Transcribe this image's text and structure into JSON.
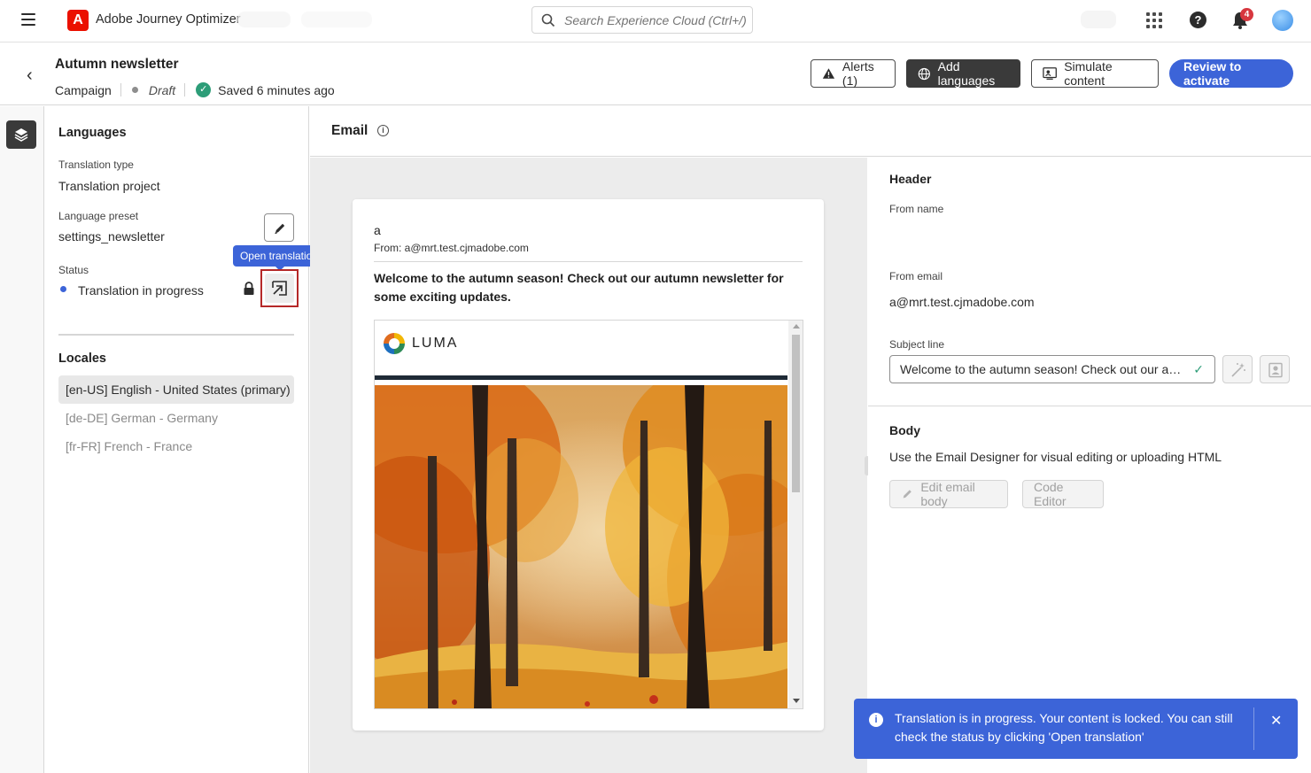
{
  "app": {
    "name": "Adobe Journey Optimizer",
    "logo_letter": "A",
    "brand_color": "#eb1000",
    "accent_color": "#3c64d8"
  },
  "search": {
    "placeholder": "Search Experience Cloud (Ctrl+/)"
  },
  "topbar": {
    "notification_count": "4",
    "help_label": "?"
  },
  "campaign": {
    "title": "Autumn newsletter",
    "type": "Campaign",
    "state": "Draft",
    "saved_text": "Saved 6 minutes ago",
    "actions": {
      "alerts": "Alerts (1)",
      "add_languages": "Add languages",
      "simulate": "Simulate content",
      "review": "Review to activate"
    }
  },
  "languages_panel": {
    "title": "Languages",
    "translation_type_label": "Translation type",
    "translation_type_value": "Translation project",
    "preset_label": "Language preset",
    "preset_value": "settings_newsletter",
    "status_label": "Status",
    "status_value": "Translation in progress",
    "status_color": "#3c64d8",
    "tooltip": "Open translation",
    "locales_title": "Locales",
    "locales": [
      {
        "label": "[en-US] English - United States (primary)",
        "active": true
      },
      {
        "label": "[de-DE] German - Germany",
        "active": false
      },
      {
        "label": "[fr-FR] French - France",
        "active": false
      }
    ]
  },
  "email": {
    "section_title": "Email",
    "info_glyph": "i",
    "from_name": "a",
    "from_line": "From: a@mrt.test.cjmadobe.com",
    "subject": "Welcome to the autumn season! Check out our autumn newsletter for some exciting updates.",
    "brand_text": "LUMA"
  },
  "settings": {
    "header_title": "Header",
    "from_name_label": "From name",
    "from_email_label": "From email",
    "from_email_value": "a@mrt.test.cjmadobe.com",
    "subject_label": "Subject line",
    "subject_value": "Welcome to the autumn season! Check out our autumn newsletter for some exciting updates.",
    "body_title": "Body",
    "body_desc": "Use the Email Designer for visual editing or uploading HTML",
    "edit_body": "Edit email body",
    "code_editor": "Code Editor"
  },
  "toast": {
    "message": "Translation is in progress. Your content is locked. You can still check the status by clicking 'Open translation'",
    "icon_glyph": "i",
    "close_glyph": "✕"
  }
}
